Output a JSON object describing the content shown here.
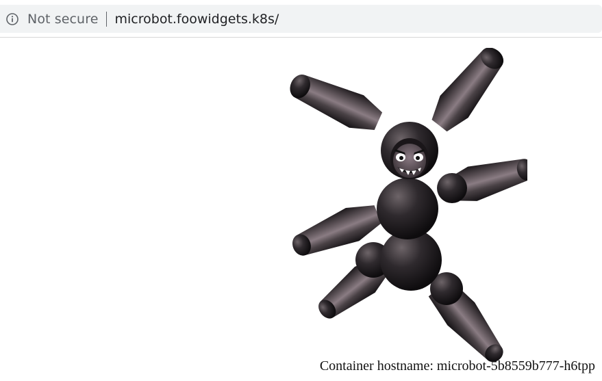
{
  "browser": {
    "info_icon": "info-circle-icon",
    "security_label": "Not secure",
    "url": "microbot.foowidgets.k8s/"
  },
  "page": {
    "image": "microbot-robot-illustration",
    "hostname_text": "Container hostname: microbot-5b8559b777-h6tpp"
  },
  "colors": {
    "omnibox_background": "#f1f3f4",
    "security_text": "#5f6368",
    "url_text": "#202124",
    "robot_body": "#2f2b2f",
    "robot_highlight": "#6e6269"
  }
}
